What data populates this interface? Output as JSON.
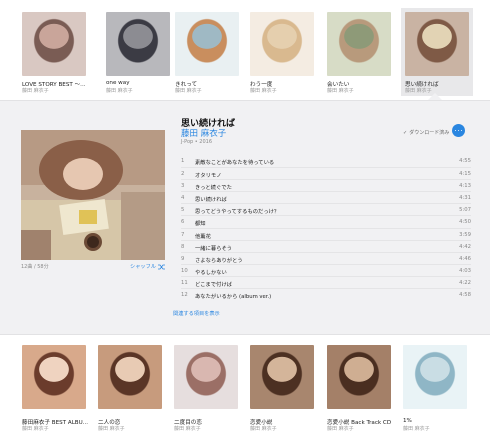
{
  "top_albums": [
    {
      "title": "LOVE STORY BEST ～...",
      "artist": "藤田 麻衣子",
      "colors": [
        "#d9c8c2",
        "#7a5c54",
        "#c9a59a"
      ]
    },
    {
      "title": "one way",
      "artist": "藤田 麻衣子",
      "colors": [
        "#b8b8bc",
        "#3b3b44",
        "#8c8c92"
      ]
    },
    {
      "title": "きれって",
      "artist": "藤田 麻衣子",
      "colors": [
        "#e9f0f2",
        "#c98e5e",
        "#9fb9c4"
      ]
    },
    {
      "title": "わう一度",
      "artist": "藤田 麻衣子",
      "colors": [
        "#f4ece2",
        "#d9b98f",
        "#e5cfae"
      ]
    },
    {
      "title": "会いたい",
      "artist": "藤田 麻衣子",
      "colors": [
        "#d7dcc6",
        "#b89a7c",
        "#8e9a78"
      ]
    },
    {
      "title": "思い続ければ",
      "artist": "藤田 麻衣子",
      "colors": [
        "#c9b3a3",
        "#7f5a46",
        "#e2d3b4"
      ]
    }
  ],
  "album": {
    "title": "思い続ければ",
    "artist": "藤田 麻衣子",
    "meta": "J-Pop • 2016",
    "download_label": "ダウンロード済み",
    "summary": "12曲 / 58分",
    "shuffle_label": "シャッフル",
    "show_related": "関連する項目を表示",
    "tracks": [
      {
        "num": "1",
        "name": "素敵なことがあなたを待っている",
        "dur": "4:55"
      },
      {
        "num": "2",
        "name": "オタリモノ",
        "dur": "4:15"
      },
      {
        "num": "3",
        "name": "きっと続ぐでた",
        "dur": "4:13"
      },
      {
        "num": "4",
        "name": "思い続ければ",
        "dur": "4:31"
      },
      {
        "num": "5",
        "name": "思ってどうやってするものだっけ？",
        "dur": "5:07"
      },
      {
        "num": "6",
        "name": "都知",
        "dur": "4:50"
      },
      {
        "num": "7",
        "name": "他薫花",
        "dur": "3:59"
      },
      {
        "num": "8",
        "name": "一緒に暮らそう",
        "dur": "4:42"
      },
      {
        "num": "9",
        "name": "さよならありがとう",
        "dur": "4:46"
      },
      {
        "num": "10",
        "name": "やるしかない",
        "dur": "4:03"
      },
      {
        "num": "11",
        "name": "どこまで付けば",
        "dur": "4:22"
      },
      {
        "num": "12",
        "name": "あなたがいるから (album ver.)",
        "dur": "4:58"
      }
    ]
  },
  "bottom_albums": [
    {
      "title": "藤田麻衣子 BEST ALBU...",
      "artist": "藤田 麻衣子",
      "colors": [
        "#d8a98b",
        "#6b3c2c",
        "#efd3c0"
      ]
    },
    {
      "title": "二人の恋",
      "artist": "藤田 麻衣子",
      "colors": [
        "#c79b7d",
        "#5a3526",
        "#e8cbb4"
      ]
    },
    {
      "title": "二度目の恋",
      "artist": "藤田 麻衣子",
      "colors": [
        "#e6dede",
        "#9b6f66",
        "#d9b7b0"
      ]
    },
    {
      "title": "恋愛小説",
      "artist": "藤田 麻衣子",
      "colors": [
        "#a8866e",
        "#4c3022",
        "#d4b59a"
      ]
    },
    {
      "title": "恋愛小説 Back Track CD",
      "artist": "藤田 麻衣子",
      "colors": [
        "#a48068",
        "#4a2e20",
        "#cfae92"
      ]
    },
    {
      "title": "1%",
      "artist": "藤田 麻衣子",
      "colors": [
        "#e9f3f6",
        "#8fb6c6",
        "#c9dde4"
      ]
    }
  ]
}
